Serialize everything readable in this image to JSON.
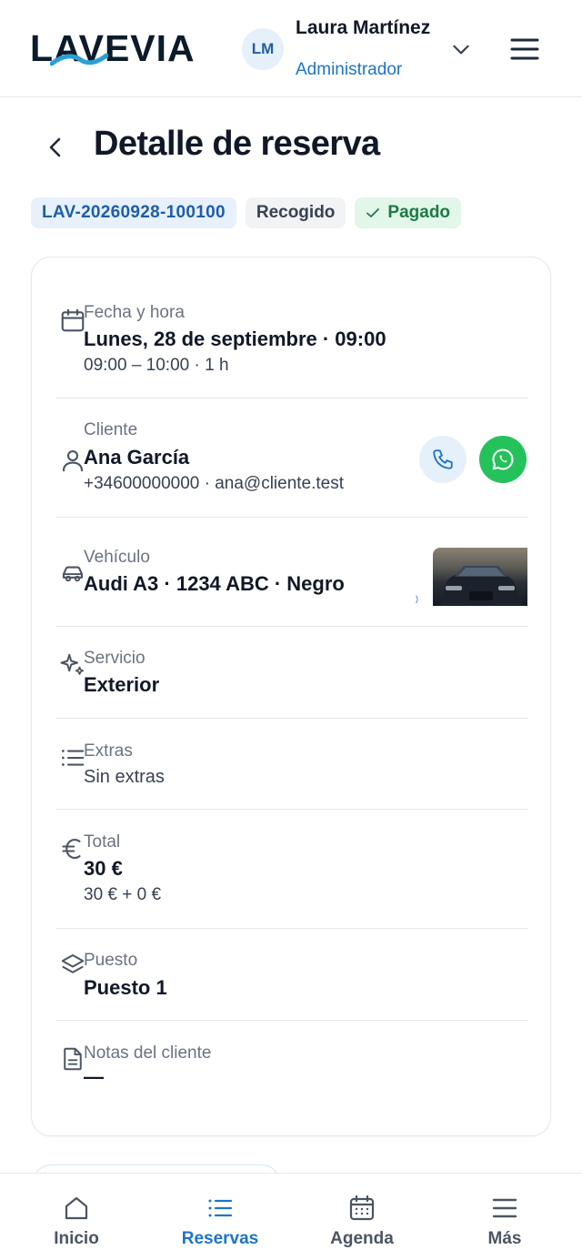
{
  "header": {
    "logo": "LAVEVIA",
    "avatar_initials": "LM",
    "user_name": "Laura Martínez",
    "user_role": "Administrador",
    "icons": [
      "chevron-down-icon",
      "hamburger-menu-icon"
    ]
  },
  "page": {
    "title": "Detalle de reserva",
    "back_icon": "chevron-left-icon"
  },
  "badges": {
    "code": "LAV-20260928-100100",
    "status": "Recogido",
    "payment": "Pagado"
  },
  "details": {
    "date": {
      "icon": "calendar-icon",
      "label": "Fecha y hora",
      "value": "Lunes, 28 de septiembre · 09:00",
      "sub": "09:00 – 10:00 · 1 h"
    },
    "client": {
      "icon": "user-icon",
      "label": "Cliente",
      "value": "Ana García",
      "sub": "+34600000000 · ana@cliente.test",
      "actions": [
        "phone-icon",
        "whatsapp-icon"
      ]
    },
    "vehicle": {
      "icon": "car-icon",
      "label": "Vehículo",
      "value": "Audi A3 · 1234 ABC · Negro"
    },
    "service": {
      "icon": "sparkles-icon",
      "label": "Servicio",
      "value": "Exterior"
    },
    "extras": {
      "icon": "list-icon",
      "label": "Extras",
      "sub": "Sin extras"
    },
    "total": {
      "icon": "euro-icon",
      "label": "Total",
      "value": "30 €",
      "sub": "30 € + 0 €"
    },
    "bay": {
      "icon": "layers-icon",
      "label": "Puesto",
      "value": "Puesto 1"
    },
    "notes": {
      "icon": "document-icon",
      "label": "Notas del cliente",
      "value": "—"
    }
  },
  "bottom_nav": {
    "items": [
      {
        "label": "Inicio",
        "icon": "home-icon",
        "active": false
      },
      {
        "label": "Reservas",
        "icon": "list-icon",
        "active": true
      },
      {
        "label": "Agenda",
        "icon": "calendar-icon",
        "active": false
      },
      {
        "label": "Más",
        "icon": "menu-icon",
        "active": false
      }
    ]
  },
  "colors": {
    "accent": "#1d74c9",
    "paid_bg": "#e2f6ea",
    "paid_text": "#1e7a45",
    "whatsapp": "#25c25c",
    "text": "#111827",
    "muted": "#6b7280"
  }
}
